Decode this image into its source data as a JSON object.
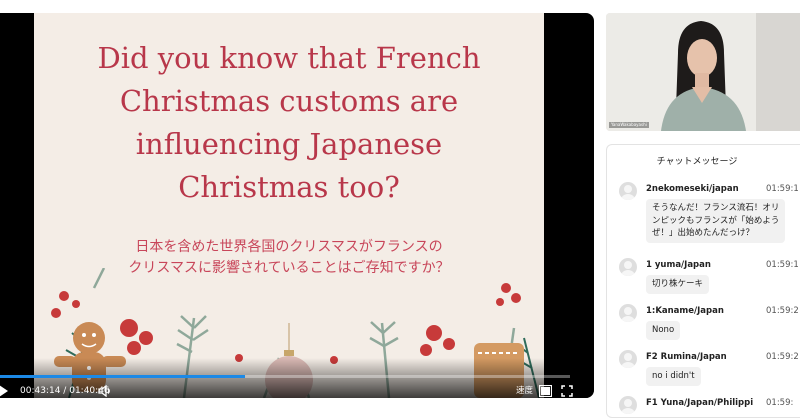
{
  "slide": {
    "title": "Did you know that French\nChristmas customs are\ninfluencing Japanese\nChristmas too?",
    "subtitle": "日本を含めた世界各国のクリスマスがフランスの\nクリスマスに影響されていることはご存知ですか？"
  },
  "player": {
    "time_current": "00:43:14",
    "time_separator": "/",
    "time_total": "01:40:46",
    "progress_fraction": 0.429,
    "speed_label": "速度",
    "accent_color": "#1c89e6"
  },
  "camera": {
    "name_tag": "YanaWakabayashi"
  },
  "chat": {
    "title": "チャットメッセージ",
    "messages": [
      {
        "user": "2nekomeseki/japan",
        "time": "01:59:1",
        "text": "そうなんだ！フランス流石！オリ\nンピックもフランスが「始めよう\nぜ！」出始めたんだっけ？"
      },
      {
        "user": "1 yuma/Japan",
        "time": "01:59:1",
        "text": "切り株ケーキ"
      },
      {
        "user": "1:Kaname/Japan",
        "time": "01:59:2",
        "text": "Nono"
      },
      {
        "user": "F2 Rumina/Japan",
        "time": "01:59:2",
        "text": "no i didn't"
      },
      {
        "user": "F1 Yuna/Japan/Philippi",
        "time": "01:59:",
        "text": ""
      }
    ]
  }
}
